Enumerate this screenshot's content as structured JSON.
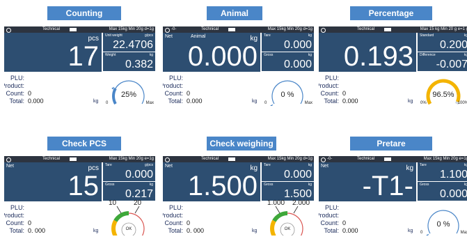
{
  "panels": [
    {
      "label": "Counting",
      "status": {
        "zero": "",
        "mode": "Technical",
        "spec": "Max 15kg Min 20g d=1g"
      },
      "main": {
        "label": "",
        "unit": "pcs",
        "value": "17"
      },
      "sub1": {
        "label": "Unit weight",
        "unit": "g/pcs",
        "value": "22.4706"
      },
      "sub2": {
        "label": "Weight",
        "unit": "kg",
        "value": "0.382"
      },
      "info": {
        "plu_label": "PLU:",
        "product_label": "Product:",
        "count_label": "Count:",
        "count_value": "0",
        "total_label": "Total:",
        "total_value": "0.000",
        "total_unit": "kg"
      },
      "gauge": {
        "type": "arc",
        "fill_fraction": 0.25,
        "center_text": "25%",
        "left_label": "0",
        "right_label": "Max"
      }
    },
    {
      "label": "Animal",
      "status": {
        "zero": "-0-",
        "mode": "Technical",
        "spec": "Max 15kg Min 20g d=1g"
      },
      "main": {
        "label": "Net",
        "sublabel": "Animal",
        "unit": "kg",
        "value": "0.000"
      },
      "sub1": {
        "label": "Tare",
        "unit": "kg",
        "value": "0.000"
      },
      "sub2": {
        "label": "Gross",
        "unit": "kg",
        "value": "0.000"
      },
      "info": {
        "plu_label": "PLU:",
        "product_label": "Product:",
        "count_label": "Count:",
        "count_value": "0",
        "total_label": "Total:",
        "total_value": "0.000",
        "total_unit": "kg"
      },
      "gauge": {
        "type": "arc",
        "fill_fraction": 0.0,
        "center_text": "0 %",
        "left_label": "0",
        "right_label": "Max"
      }
    },
    {
      "label": "Percentage",
      "status": {
        "zero": "",
        "mode": "Technical",
        "spec": "Max 15 kg Min 20 g e=1 g"
      },
      "main": {
        "label": "",
        "unit": "",
        "value": "0.193"
      },
      "sub1": {
        "label": "Standard",
        "unit": "kg",
        "value": "0.200"
      },
      "sub2": {
        "label": "Difference",
        "unit": "kg",
        "value": "-0.007"
      },
      "info": {
        "plu_label": "PLU:",
        "product_label": "Product:",
        "count_label": "Count:",
        "count_value": "0",
        "total_label": "Total:",
        "total_value": "0.000",
        "total_unit": "kg"
      },
      "gauge": {
        "type": "percent",
        "fill_fraction": 0.965,
        "center_text": "96.5%",
        "left_label": "0%",
        "right_label": "100%"
      }
    },
    {
      "label": "Check PCS",
      "status": {
        "zero": "",
        "mode": "Technical",
        "spec": "Max 15kg Min 20g e=1g"
      },
      "main": {
        "label": "Net",
        "unit": "pcs",
        "value": "15"
      },
      "sub1": {
        "label": "Tare",
        "unit": "g/pcs",
        "value": "0.000"
      },
      "sub2": {
        "label": "Gross",
        "unit": "kg",
        "value": "0.217"
      },
      "info": {
        "plu_label": "PLU:",
        "product_label": "Product:",
        "count_label": "Count:",
        "count_value": "0",
        "total_label": "Total:",
        "total_value": "0. 000",
        "total_unit": "kg"
      },
      "gauge": {
        "type": "check",
        "center_text": "OK",
        "low_limit": "10",
        "high_limit": "20"
      }
    },
    {
      "label": "Check weighing",
      "status": {
        "zero": "",
        "mode": "Technical",
        "spec": "Max 15kg Min 20g d=1g"
      },
      "main": {
        "label": "Net",
        "unit": "kg",
        "value": "1.500"
      },
      "sub1": {
        "label": "Tare",
        "unit": "kg",
        "value": "0.000"
      },
      "sub2": {
        "label": "Gross",
        "unit": "kg",
        "value": "1.500"
      },
      "info": {
        "plu_label": "PLU:",
        "product_label": "Product:",
        "count_label": "Count:",
        "count_value": "0",
        "total_label": "Total:",
        "total_value": "0. 000",
        "total_unit": "kg"
      },
      "gauge": {
        "type": "check",
        "center_text": "OK",
        "low_limit": "1.000",
        "high_limit": "2.000"
      }
    },
    {
      "label": "Pretare",
      "status": {
        "zero": "-0-",
        "mode": "Technical",
        "spec": "Max 15kg Min 20g e=1g"
      },
      "main": {
        "label": "Net",
        "unit": "kg",
        "value": "-T1-"
      },
      "sub1": {
        "label": "Tare",
        "unit": "kg",
        "value": "1.100"
      },
      "sub2": {
        "label": "Gross",
        "unit": "kg",
        "value": "0.000"
      },
      "info": {
        "plu_label": "PLU:",
        "product_label": "Product:",
        "count_label": "Count:",
        "count_value": "0",
        "total_label": "Total:",
        "total_value": "0.000",
        "total_unit": "kg"
      },
      "gauge": {
        "type": "arc",
        "fill_fraction": 0.0,
        "center_text": "0 %",
        "left_label": "0",
        "right_label": "Max"
      }
    }
  ],
  "colors": {
    "label_bg": "#4a86c8",
    "panel": "#2d4e71",
    "status_bar": "#2d3440",
    "arc": "#4a86c8",
    "gold": "#f4b400",
    "green": "#3ea83a",
    "red": "#d9534f"
  }
}
